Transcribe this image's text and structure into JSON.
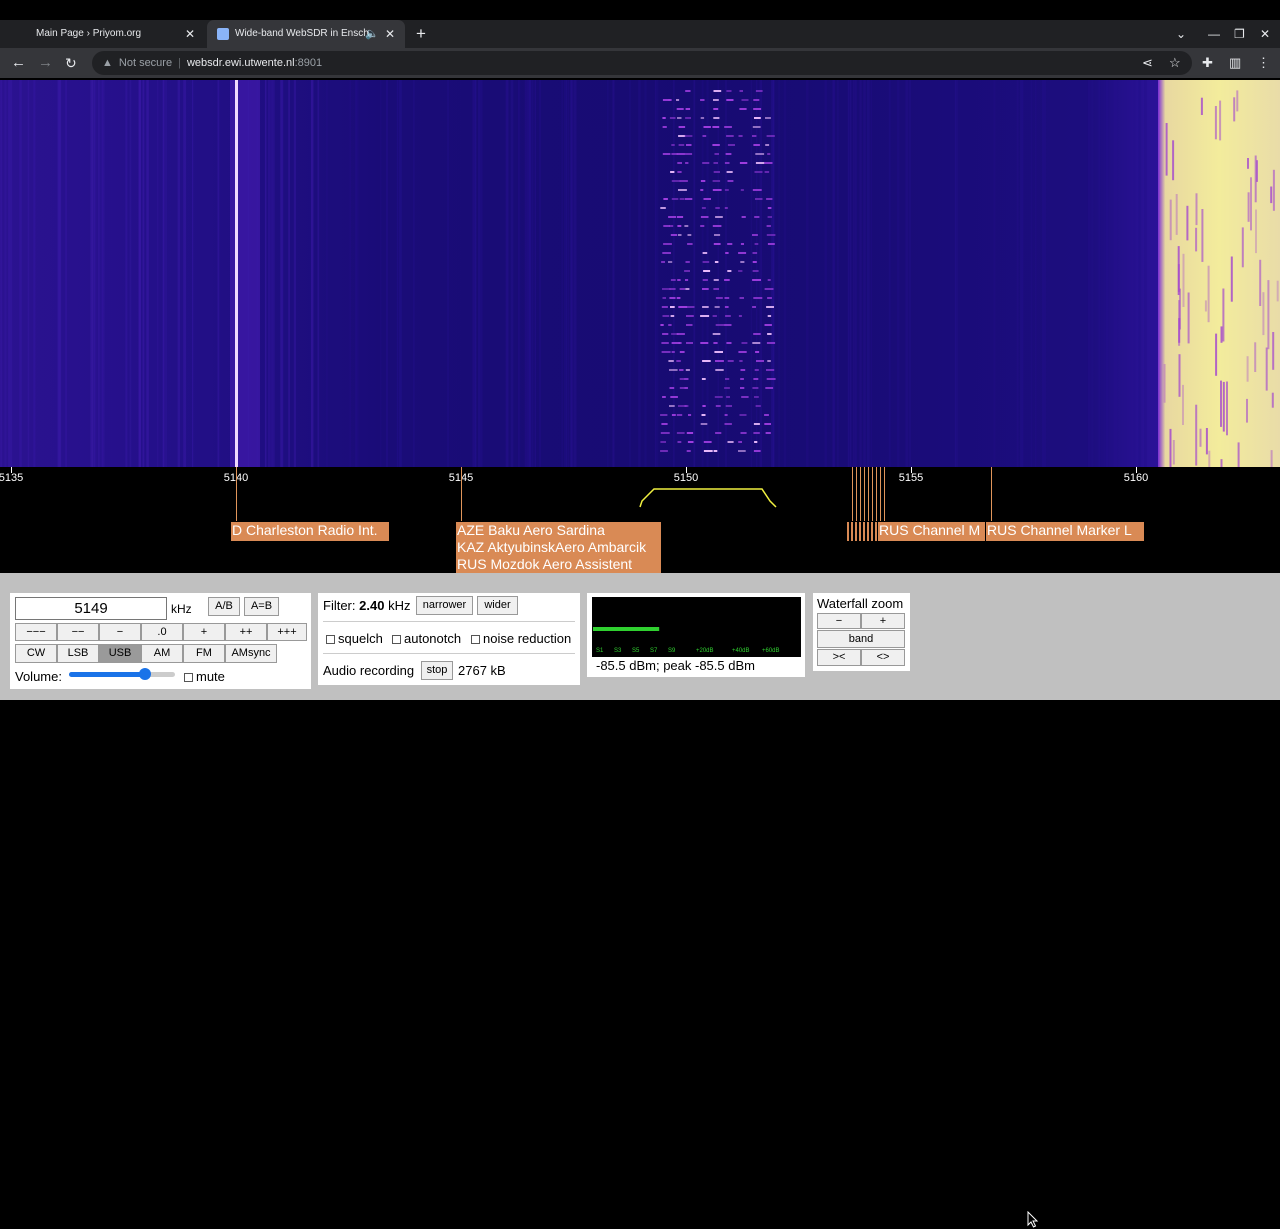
{
  "browser": {
    "tabs": [
      {
        "title": "Main Page › Priyom.org"
      },
      {
        "title": "Wide-band WebSDR in Ensch"
      }
    ],
    "address": {
      "security": "Not secure",
      "host": "websdr.ewi.utwente.nl",
      "port": ":8901"
    }
  },
  "scale": {
    "ticks": [
      "5135",
      "5140",
      "5145",
      "5150",
      "5155",
      "5160"
    ]
  },
  "stations": {
    "charleston": "D Charleston Radio Int.",
    "aero": [
      "AZE Baku Aero Sardina",
      "KAZ AktyubinskAero Ambarcik",
      "RUS Mozdok Aero Assistent"
    ],
    "rus_m": "RUS Channel M",
    "rus_l": "RUS Channel Marker L"
  },
  "freq_panel": {
    "frequency": "5149",
    "unit": "kHz",
    "ab": "A/B",
    "aeqb": "A=B",
    "steps": [
      "−−−",
      "−−",
      "−",
      ".0",
      "+",
      "++",
      "+++"
    ],
    "modes": [
      "CW",
      "LSB",
      "USB",
      "AM",
      "FM",
      "AMsync"
    ],
    "active_mode": "USB",
    "volume_label": "Volume:",
    "volume_level": 0.72,
    "mute_label": "mute"
  },
  "filter_panel": {
    "label": "Filter:",
    "width": "2.40",
    "unit": "kHz",
    "narrower": "narrower",
    "wider": "wider",
    "squelch": "squelch",
    "autonotch": "autonotch",
    "noise_reduction": "noise reduction",
    "audio_recording": "Audio recording",
    "stop": "stop",
    "size": "2767 kB"
  },
  "smeter": {
    "scale": [
      "S1",
      "S3",
      "S5",
      "S7",
      "S9",
      "+20dB",
      "+40dB",
      "+60dB"
    ],
    "reading": "-85.5 dBm; peak  -85.5 dBm",
    "level": 0.32
  },
  "zoom_panel": {
    "title": "Waterfall zoom",
    "minus": "−",
    "plus": "+",
    "band": "band",
    "narrow": "><",
    "wide": "<>"
  }
}
